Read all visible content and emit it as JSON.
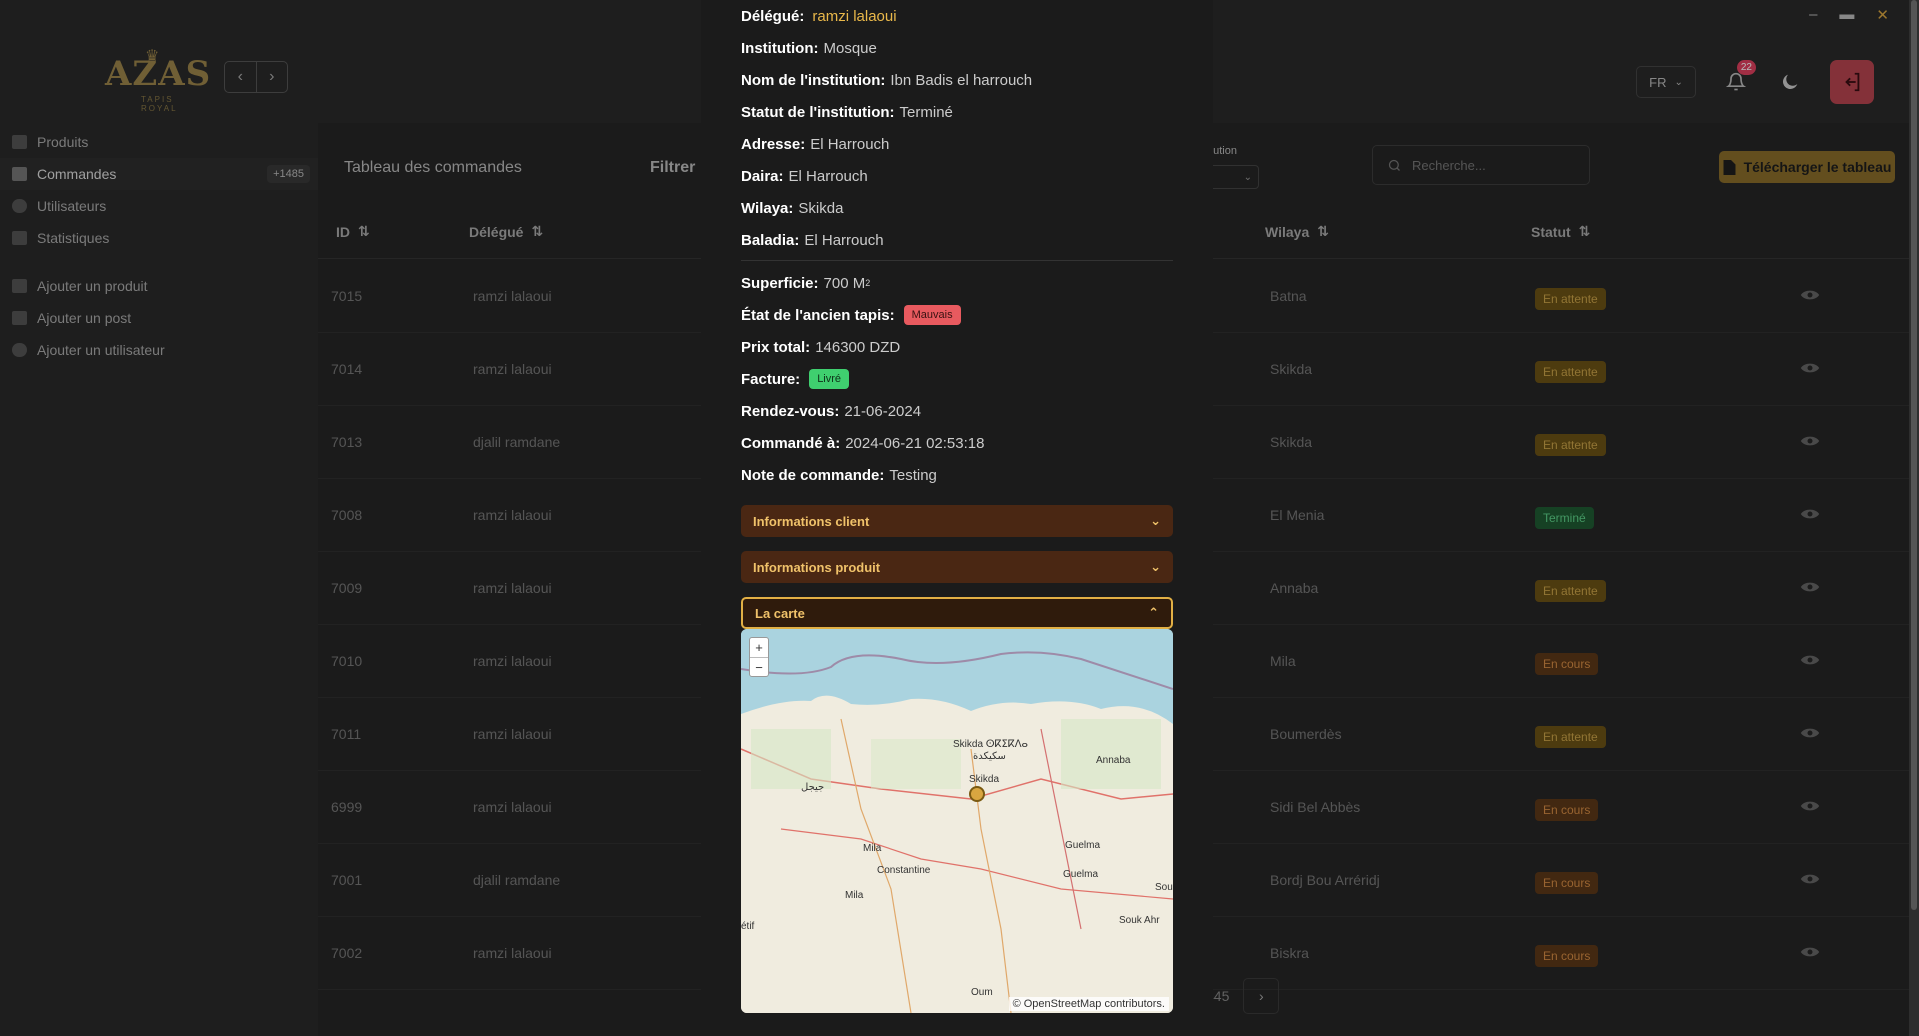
{
  "brand": {
    "name": "AZAS",
    "tagline": "TAPIS ROYAL"
  },
  "header": {
    "language": "FR",
    "notification_count": "22"
  },
  "sidebar": {
    "items": [
      {
        "label": "Produits",
        "icon": "box-icon"
      },
      {
        "label": "Commandes",
        "icon": "cart-icon",
        "count": "+1485"
      },
      {
        "label": "Utilisateurs",
        "icon": "users-icon"
      },
      {
        "label": "Statistiques",
        "icon": "chart-icon"
      }
    ],
    "actions": [
      {
        "label": "Ajouter un produit",
        "icon": "add-product-icon"
      },
      {
        "label": "Ajouter un post",
        "icon": "add-post-icon"
      },
      {
        "label": "Ajouter un utilisateur",
        "icon": "add-user-icon"
      }
    ]
  },
  "main": {
    "title": "Tableau des commandes",
    "filter_label": "Filtrer",
    "institution_filter_label": "ıtution",
    "search_placeholder": "Recherche...",
    "download_label": "Télécharger le tableau",
    "columns": {
      "id": "ID",
      "delegue": "Délégué",
      "wilaya": "Wilaya",
      "statut": "Statut"
    },
    "rows": [
      {
        "id": "7015",
        "delegue": "ramzi lalaoui",
        "wilaya": "Batna",
        "statut": "En attente",
        "kind": "wait"
      },
      {
        "id": "7014",
        "delegue": "ramzi lalaoui",
        "wilaya": "Skikda",
        "statut": "En attente",
        "kind": "wait"
      },
      {
        "id": "7013",
        "delegue": "djalil ramdane",
        "wilaya": "Skikda",
        "statut": "En attente",
        "kind": "wait"
      },
      {
        "id": "7008",
        "delegue": "ramzi lalaoui",
        "wilaya": "El Menia",
        "statut": "Terminé",
        "kind": "done"
      },
      {
        "id": "7009",
        "delegue": "ramzi lalaoui",
        "wilaya": "Annaba",
        "statut": "En attente",
        "kind": "wait"
      },
      {
        "id": "7010",
        "delegue": "ramzi lalaoui",
        "wilaya": "Mila",
        "statut": "En cours",
        "kind": "prog"
      },
      {
        "id": "7011",
        "delegue": "ramzi lalaoui",
        "wilaya": "Boumerdès",
        "statut": "En attente",
        "kind": "wait"
      },
      {
        "id": "6999",
        "delegue": "ramzi lalaoui",
        "wilaya": "Sidi Bel Abbès",
        "statut": "En cours",
        "kind": "prog"
      },
      {
        "id": "7001",
        "delegue": "djalil ramdane",
        "wilaya": "Bordj Bou Arréridj",
        "statut": "En cours",
        "kind": "prog"
      },
      {
        "id": "7002",
        "delegue": "ramzi lalaoui",
        "wilaya": "Biskra",
        "statut": "En cours",
        "kind": "prog"
      }
    ],
    "pager_last": "445"
  },
  "modal": {
    "delegue_label": "Délégué:",
    "delegue_value": "ramzi lalaoui",
    "institution_label": "Institution:",
    "institution_value": "Mosque",
    "nom_label": "Nom de l'institution:",
    "nom_value": "Ibn Badis el harrouch",
    "statut_label": "Statut de l'institution:",
    "statut_value": "Terminé",
    "adresse_label": "Adresse:",
    "adresse_value": "El Harrouch",
    "daira_label": "Daira:",
    "daira_value": "El Harrouch",
    "wilaya_label": "Wilaya:",
    "wilaya_value": "Skikda",
    "baladia_label": "Baladia:",
    "baladia_value": "El Harrouch",
    "superficie_label": "Superficie:",
    "superficie_value": "700 M",
    "superficie_exp": "2",
    "etat_label": "État de l'ancien tapis:",
    "etat_value": "Mauvais",
    "prix_label": "Prix total:",
    "prix_value": "146300 DZD",
    "facture_label": "Facture:",
    "facture_value": "Livré",
    "rdv_label": "Rendez-vous:",
    "rdv_value": "21-06-2024",
    "commande_label": "Commandé à:",
    "commande_value": "2024-06-21 02:53:18",
    "note_label": "Note de commande:",
    "note_value": "Testing",
    "acc_client": "Informations client",
    "acc_produit": "Informations produit",
    "acc_carte": "La carte",
    "map": {
      "attribution": "© OpenStreetMap contributors.",
      "labels": [
        "Skikda ⵙⴽⵉⴽⴷⴰ",
        "سكيكدة",
        "Skikda",
        "Annaba",
        "Mila",
        "Constantine",
        "Guelma",
        "Souk Ahr",
        "Sou",
        "Mila",
        "Guelma",
        "جيجل",
        "étif",
        "Oum"
      ]
    }
  }
}
